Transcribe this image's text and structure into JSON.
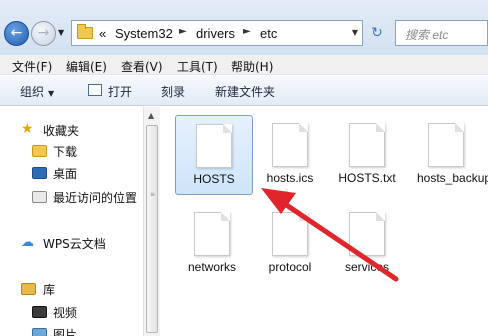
{
  "address_bar": {
    "history_overflow": "«",
    "crumbs": [
      "System32",
      "drivers",
      "etc"
    ],
    "search_placeholder": "搜索 etc"
  },
  "menu": [
    "文件(F)",
    "编辑(E)",
    "查看(V)",
    "工具(T)",
    "帮助(H)"
  ],
  "commands": {
    "organize": "组织",
    "open": "打开",
    "burn": "刻录",
    "new_folder": "新建文件夹"
  },
  "sidebar": {
    "favorites": "收藏夹",
    "downloads": "下载",
    "desktop": "桌面",
    "recent": "最近访问的位置",
    "wps": "WPS云文档",
    "libraries": "库",
    "videos": "视频",
    "pictures": "图片"
  },
  "files": [
    {
      "name": "HOSTS",
      "selected": true
    },
    {
      "name": "hosts.ics",
      "selected": false
    },
    {
      "name": "HOSTS.txt",
      "selected": false
    },
    {
      "name": "hosts_backup",
      "selected": false
    },
    {
      "name": "networks",
      "selected": false
    },
    {
      "name": "protocol",
      "selected": false
    },
    {
      "name": "services",
      "selected": false
    }
  ],
  "colors": {
    "selection_fill": "#cfe4fa",
    "annotation_arrow": "#e0262b",
    "accent": "#1f5fb5"
  }
}
